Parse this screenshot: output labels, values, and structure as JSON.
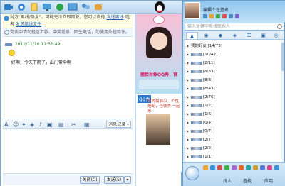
{
  "chat": {
    "notice_text": "对方\"离线/隐身\"，可能无法立即回复，您可以向他",
    "notice_link1": "发送离线",
    "notice_mid": "或者",
    "notice_link2": "发送离线文件",
    "security_text": "交谈中请勿轻信汇款、中奖信息、陌生电话，勿使用外挂软件。",
    "sender_time": "2012/11/10 11:31:49",
    "message": "· 好啊，今天下雨了，出门带伞啊",
    "history_label": "消息记录",
    "close_label": "关闭(C)",
    "send_label": "发送(S)"
  },
  "ads": {
    "ad1_title": "撞脸对象QQ秀，官",
    "ad2_badge": "QQ秀",
    "ad2_text": "时尚最前沿，个性搭配，任你秀 一起来"
  },
  "qq": {
    "signature": "编辑个性签名",
    "search_placeholder": "输入关键字查找联系人",
    "groups": [
      "我的好友 [14/73]",
      "[10/42]",
      "[2/11]",
      "[8/33]",
      "[8/8]",
      "[8/43]",
      "[2/76]",
      "[1/2]",
      "[1/6]",
      "[0/4]",
      "[0/7]",
      "[2/7]",
      "[2/2]",
      "[1/1]"
    ],
    "foot_labels": [
      "找人",
      "查找",
      "应用"
    ]
  },
  "colors": {
    "accent": "#2b78c9",
    "chat_bg": "#cfe6f8",
    "list_bg": "#ffffff"
  }
}
